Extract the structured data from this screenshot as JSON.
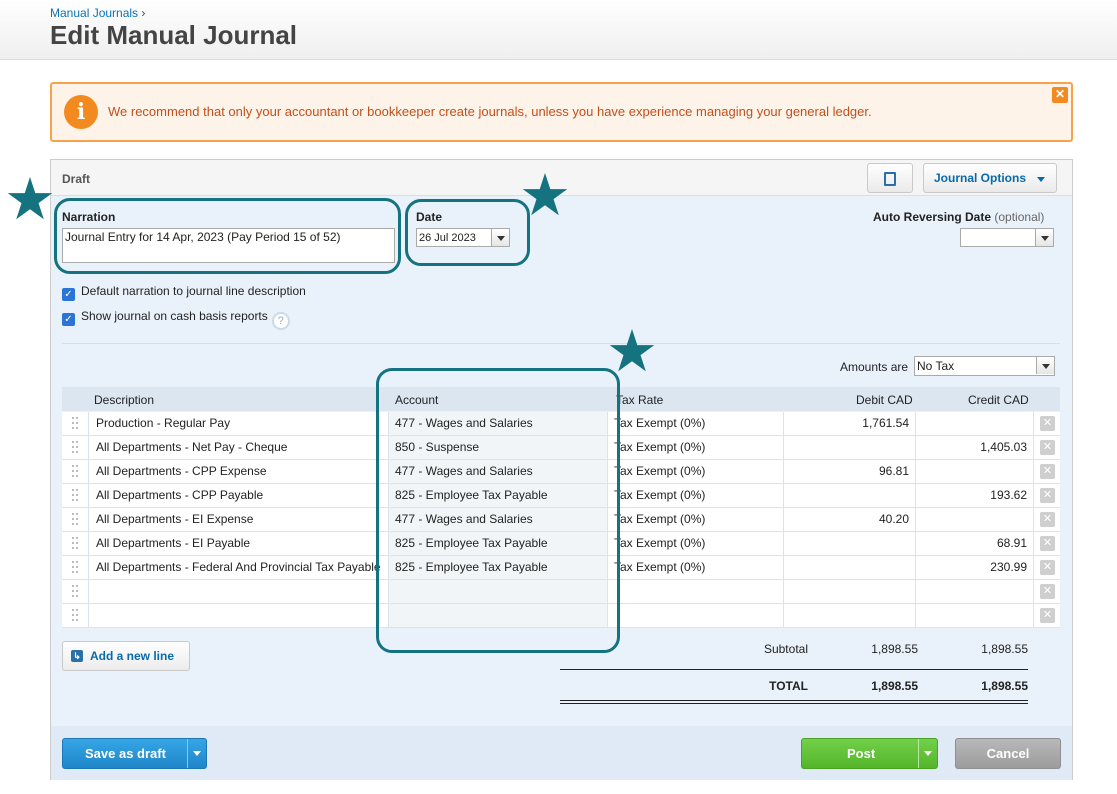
{
  "breadcrumb": {
    "link": "Manual Journals",
    "separator": "›"
  },
  "page_title": "Edit Manual Journal",
  "alert": {
    "icon": "info-icon",
    "text": "We recommend that only your accountant or bookkeeper create journals, unless you have experience managing your general ledger.",
    "close": "✕"
  },
  "panel": {
    "status": "Draft",
    "journal_options": "Journal Options"
  },
  "form": {
    "narration_label": "Narration",
    "narration_value": "Journal Entry for 14 Apr, 2023 (Pay Period 15 of 52)",
    "date_label": "Date",
    "date_value": "26 Jul 2023",
    "reversing_label": "Auto Reversing Date",
    "reversing_optional": "(optional)",
    "reversing_value": "",
    "default_narration_label": "Default narration to journal line description",
    "cash_basis_label": "Show journal on cash basis reports",
    "amounts_are_label": "Amounts are",
    "amounts_are_value": "No Tax"
  },
  "columns": {
    "description": "Description",
    "account": "Account",
    "tax_rate": "Tax Rate",
    "debit": "Debit CAD",
    "credit": "Credit CAD"
  },
  "lines": [
    {
      "description": "Production - Regular Pay",
      "account": "477 - Wages and Salaries",
      "tax": "Tax Exempt (0%)",
      "debit": "1,761.54",
      "credit": ""
    },
    {
      "description": "All Departments - Net Pay - Cheque",
      "account": "850 - Suspense",
      "tax": "Tax Exempt (0%)",
      "debit": "",
      "credit": "1,405.03"
    },
    {
      "description": "All Departments - CPP Expense",
      "account": "477 - Wages and Salaries",
      "tax": "Tax Exempt (0%)",
      "debit": "96.81",
      "credit": ""
    },
    {
      "description": "All Departments - CPP Payable",
      "account": "825 - Employee Tax Payable",
      "tax": "Tax Exempt (0%)",
      "debit": "",
      "credit": "193.62"
    },
    {
      "description": "All Departments - EI Expense",
      "account": "477 - Wages and Salaries",
      "tax": "Tax Exempt (0%)",
      "debit": "40.20",
      "credit": ""
    },
    {
      "description": "All Departments - EI Payable",
      "account": "825 - Employee Tax Payable",
      "tax": "Tax Exempt (0%)",
      "debit": "",
      "credit": "68.91"
    },
    {
      "description": "All Departments - Federal And Provincial Tax Payable",
      "account": "825 - Employee Tax Payable",
      "tax": "Tax Exempt (0%)",
      "debit": "",
      "credit": "230.99"
    },
    {
      "description": "",
      "account": "",
      "tax": "",
      "debit": "",
      "credit": ""
    },
    {
      "description": "",
      "account": "",
      "tax": "",
      "debit": "",
      "credit": ""
    }
  ],
  "add_line": "Add a new line",
  "totals": {
    "subtotal_label": "Subtotal",
    "subtotal_debit": "1,898.55",
    "subtotal_credit": "1,898.55",
    "total_label": "TOTAL",
    "total_debit": "1,898.55",
    "total_credit": "1,898.55"
  },
  "footer": {
    "save_as_draft": "Save as draft",
    "post": "Post",
    "cancel": "Cancel"
  },
  "annotations": {
    "star_glyph": "★",
    "color": "#15737f"
  }
}
